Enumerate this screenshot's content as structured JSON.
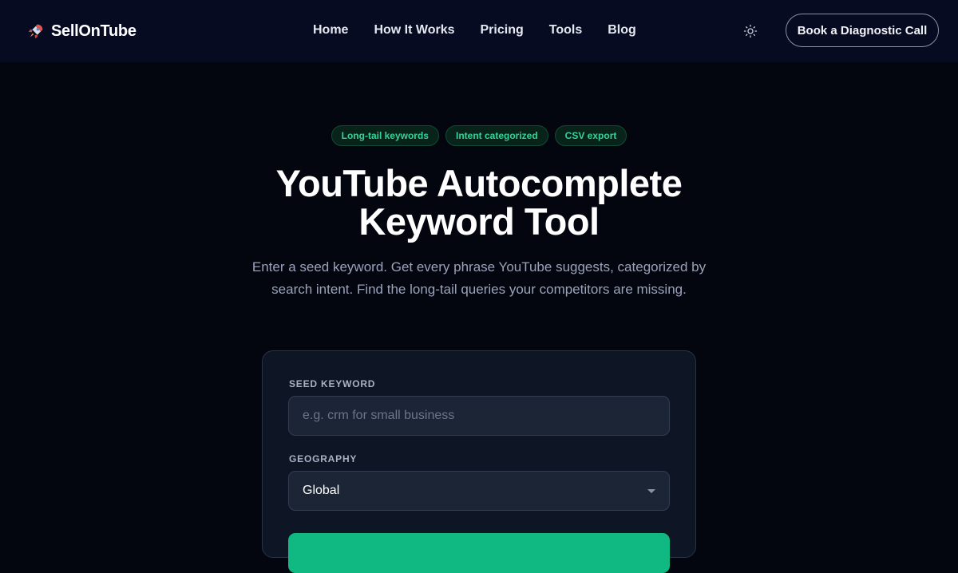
{
  "nav": {
    "brand": "SellOnTube",
    "brand_icon": "rocket-icon",
    "links": [
      "Home",
      "How It Works",
      "Pricing",
      "Tools",
      "Blog"
    ],
    "theme_icon": "sun-icon",
    "cta_label": "Book a Diagnostic Call"
  },
  "hero": {
    "badges": [
      "Long-tail keywords",
      "Intent categorized",
      "CSV export"
    ],
    "title_line1": "YouTube Autocomplete",
    "title_line2": "Keyword Tool",
    "subtitle_line1": "Enter a seed keyword. Get every phrase YouTube suggests, categorized by",
    "subtitle_line2": "search intent. Find the long-tail queries your competitors are missing."
  },
  "form": {
    "seed_label": "SEED KEYWORD",
    "seed_value": "",
    "seed_placeholder": "e.g. crm for small business",
    "geo_label": "GEOGRAPHY",
    "geo_selected": "Global",
    "geo_icon": "chevron-down-icon"
  },
  "colors": {
    "page_bg": "#03060f",
    "nav_bg": "#070b22",
    "accent_green": "#10b981",
    "badge_text": "#34d399",
    "card_bg": "#0e1524"
  }
}
